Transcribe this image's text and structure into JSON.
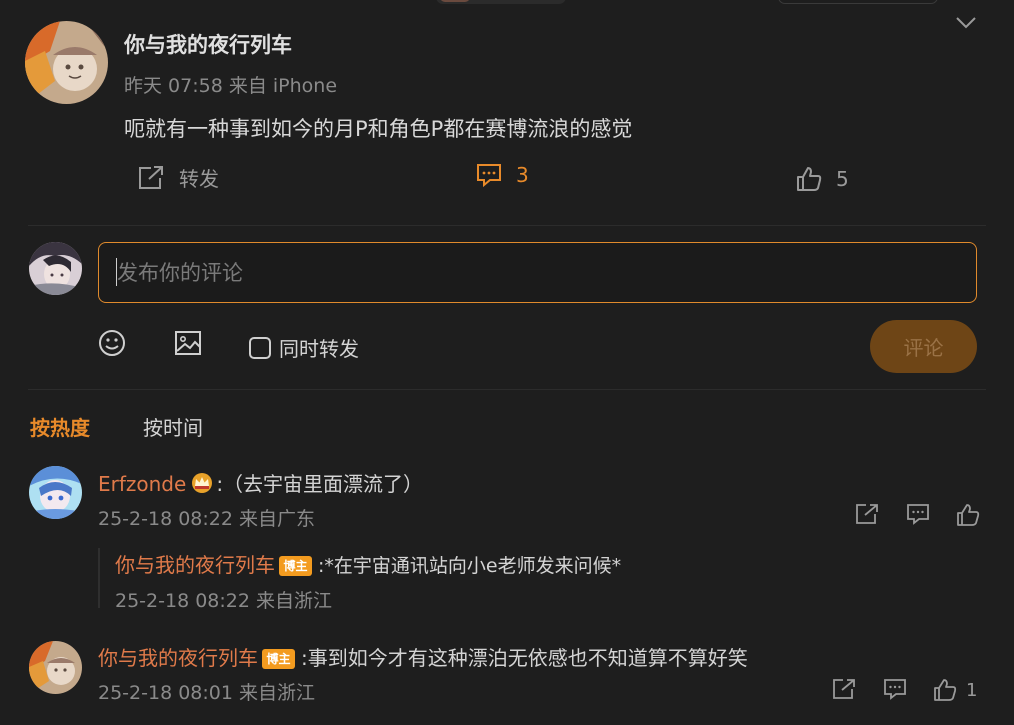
{
  "post": {
    "author": "你与我的夜行列车",
    "meta": "昨天 07:58  来自 iPhone",
    "text": "呃就有一种事到如今的月P和角色P都在赛博流浪的感觉",
    "actions": {
      "repost_label": "转发",
      "comment_count": "3",
      "like_count": "5"
    }
  },
  "composer": {
    "placeholder": "发布你的评论",
    "repost_checkbox_label": "同时转发",
    "submit_label": "评论"
  },
  "sort_tabs": {
    "hot": "按热度",
    "time": "按时间"
  },
  "comments": [
    {
      "name": "Erfzonde",
      "text": ":（去宇宙里面漂流了）",
      "meta": "25-2-18 08:22  来自广东",
      "reply": {
        "name": "你与我的夜行列车",
        "badge": "博主",
        "text": ":*在宇宙通讯站向小e老师发来问候*",
        "meta": "25-2-18 08:22  来自浙江"
      }
    },
    {
      "name": "你与我的夜行列车",
      "badge": "博主",
      "text": ":事到如今才有这种漂泊无依感也不知道算不算好笑",
      "meta": "25-2-18 08:01  来自浙江",
      "like_count": "1"
    }
  ],
  "colors": {
    "accent": "#e88a2a",
    "background": "#1e1e1e",
    "name_color": "#e07a4a",
    "badge": "#f39b1f"
  },
  "icons": [
    "chevron-down-icon",
    "repost-icon",
    "comment-icon",
    "like-icon",
    "emoji-icon",
    "image-icon",
    "crown-icon"
  ]
}
